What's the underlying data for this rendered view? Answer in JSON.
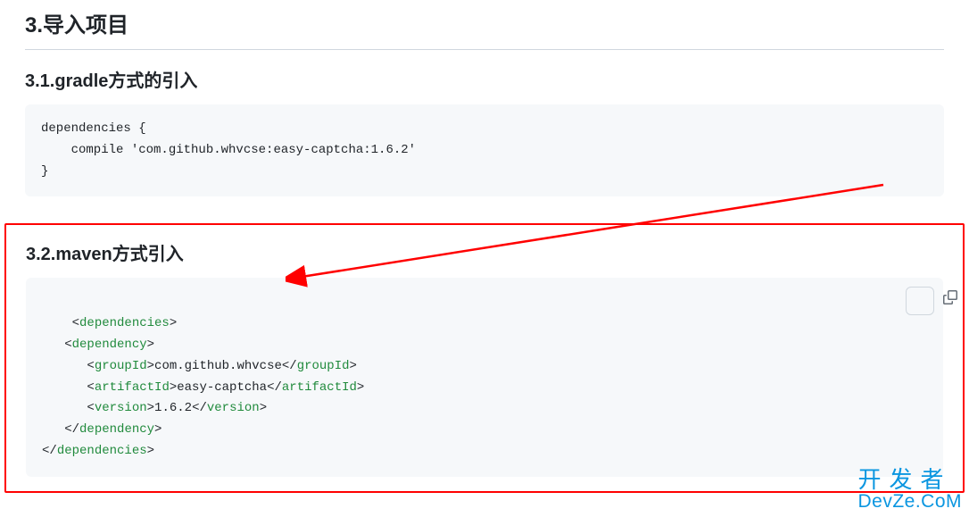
{
  "heading_main": "3.导入项目",
  "section1": {
    "heading": "3.1.gradle方式的引入",
    "code": "dependencies {\n    compile 'com.github.whvcse:easy-captcha:1.6.2'\n}"
  },
  "section2": {
    "heading": "3.2.maven方式引入",
    "xml": {
      "root_tag": "dependencies",
      "dep_tag": "dependency",
      "group_tag": "groupId",
      "group_val": "com.github.whvcse",
      "artifact_tag": "artifactId",
      "artifact_val": "easy-captcha",
      "version_tag": "version",
      "version_val": "1.6.2"
    }
  },
  "watermark": {
    "line1": "开发者",
    "line2": "DevZe.CoM"
  }
}
